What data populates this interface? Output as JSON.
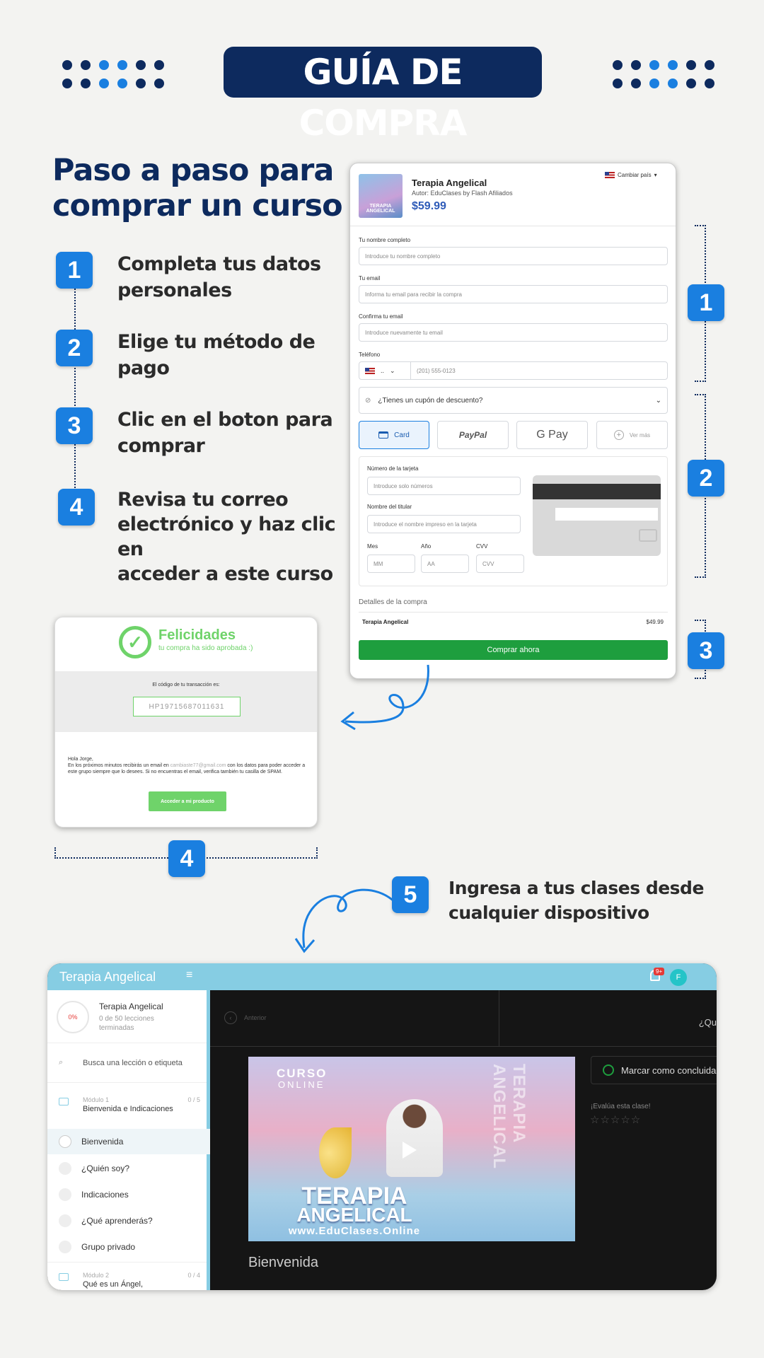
{
  "banner": {
    "title": "GUÍA DE COMPRA"
  },
  "heading": {
    "line1": "Paso a paso para",
    "line2": "comprar un curso"
  },
  "steps": [
    {
      "num": "1",
      "line1": "Completa tus datos",
      "line2": "personales",
      "line3": ""
    },
    {
      "num": "2",
      "line1": "Elige tu método de",
      "line2": "pago",
      "line3": ""
    },
    {
      "num": "3",
      "line1": "Clic en el boton para",
      "line2": "comprar",
      "line3": ""
    },
    {
      "num": "4",
      "line1": "Revisa tu correo",
      "line2": "electrónico y haz clic en",
      "line3": "acceder a este curso"
    }
  ],
  "checkout": {
    "country": "Cambiar país",
    "product": {
      "name": "Terapia Angelical",
      "author": "Autor: EduClases by Flash Afiliados",
      "price": "$59.99",
      "thumb_text": "TERAPIA ANGELICAL"
    },
    "fields": [
      {
        "label": "Tu nombre completo",
        "placeholder": "Introduce tu nombre completo"
      },
      {
        "label": "Tu email",
        "placeholder": "Informa tu email para recibir la compra"
      },
      {
        "label": "Confirma tu email",
        "placeholder": "Introduce nuevamente tu email"
      }
    ],
    "phone": {
      "label": "Teléfono",
      "code": "..",
      "placeholder": "(201) 555-0123"
    },
    "coupon": "¿Tienes un cupón de descuento?",
    "pay": {
      "card": "Card",
      "paypal": "PayPal",
      "gpay": "G Pay",
      "more": "Ver más"
    },
    "card_form": {
      "number_label": "Número de la tarjeta",
      "number_ph": "Introduce solo números",
      "holder_label": "Nombre del titular",
      "holder_ph": "Introduce el nombre impreso en la tarjeta",
      "month_label": "Mes",
      "month_ph": "MM",
      "year_label": "Año",
      "year_ph": "AA",
      "cvv_label": "CVV",
      "cvv_ph": "CVV"
    },
    "details": {
      "title": "Detalles de la compra",
      "item": "Terapia Angelical",
      "price": "$49.99"
    },
    "buy_button": "Comprar ahora"
  },
  "bracket_labels": [
    "1",
    "2",
    "3"
  ],
  "success": {
    "title": "Felicidades",
    "subtitle": "tu compra ha sido aprobada :)",
    "code_label": "El código de tu transacción es:",
    "code": "HP19715687011631",
    "greeting": "Hola Jorge,",
    "body_a": "En los próximos minutos recibirás un email en",
    "email": "cambiaste77@gmail.com",
    "body_b": "con los datos para poder acceder a este grupo siempre que lo desees. Si no encuentras el email, verifica también tu casilla de SPAM.",
    "button": "Acceder a mi producto",
    "step_num": "4"
  },
  "step5": {
    "num": "5",
    "line1": "Ingresa a tus clases desde",
    "line2": "cualquier dispositivo"
  },
  "platform": {
    "title": "Terapia Angelical",
    "menu_icon": "≡",
    "badge": "9+",
    "avatar": "F",
    "course": {
      "progress": "0%",
      "name": "Terapia Angelical",
      "lessons": "0 de 50 lecciones",
      "lessons2": "terminadas"
    },
    "search": "Busca una lección o etiqueta",
    "module1": {
      "label": "Módulo 1",
      "count": "0 / 5",
      "title": "Bienvenida e Indicaciones"
    },
    "lessons": [
      "Bienvenida",
      "¿Quién soy?",
      "Indicaciones",
      "¿Qué aprenderás?",
      "Grupo privado"
    ],
    "module2": {
      "label": "Módulo 2",
      "count": "0 / 4",
      "title": "Qué es un Ángel,"
    },
    "prev": "Anterior",
    "next_partial": "¿Qu",
    "video": {
      "top1": "CURSO",
      "top2": "ONLINE",
      "title1": "TERAPIA",
      "title2": "ANGELICAL",
      "url": "www.EduClases.Online",
      "side": "TERAPIA ANGELICAL"
    },
    "mark_done": "Marcar como concluida",
    "rate": "¡Evalúa esta clase!",
    "lesson_title": "Bienvenida"
  },
  "colors": {
    "navy": "#0d2a5e",
    "blue": "#1a7fe0",
    "green": "#1e9e3e",
    "success_green": "#6fd36a",
    "teal": "#86cde3"
  }
}
